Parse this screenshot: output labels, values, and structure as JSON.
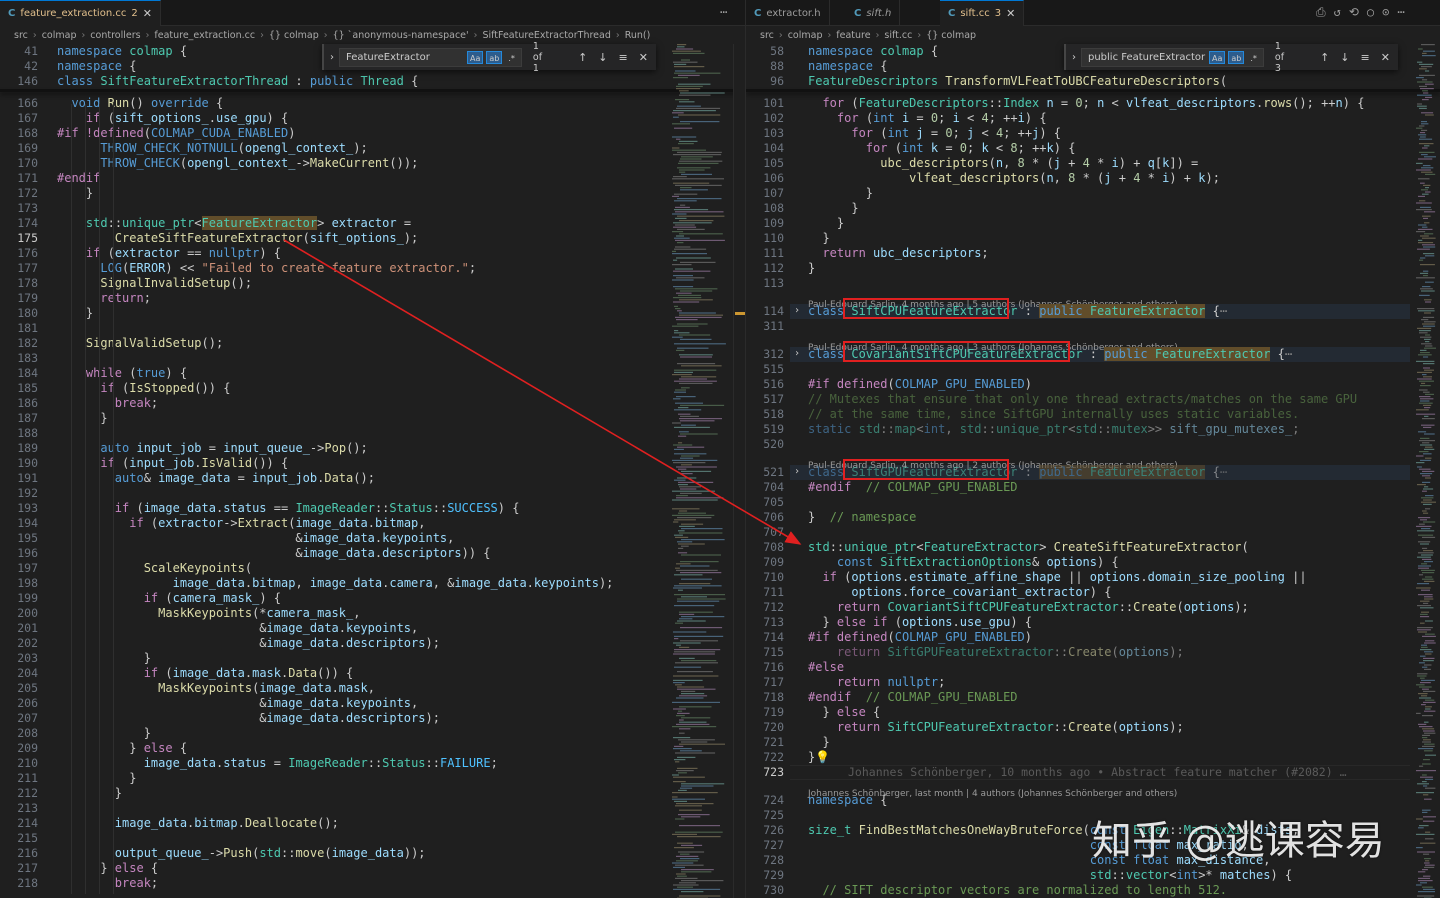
{
  "left": {
    "tabs": [
      {
        "icon": "C",
        "label": "feature_extraction.cc",
        "badge": "2",
        "active": true
      }
    ],
    "breadcrumb": [
      "src",
      "colmap",
      "controllers",
      "feature_extraction.cc",
      "{} colmap",
      "{} `anonymous-namespace'",
      "SiftFeatureExtractorThread",
      "Run()"
    ],
    "find_widget": {
      "value": "FeatureExtractor",
      "case_label": "Aa",
      "word_label": "ab",
      "regex_label": ".*",
      "count": "1 of 1"
    },
    "sticky_lines": [
      {
        "num": "41",
        "html": "<span class='k'>namespace</span> <span class='t'>colmap</span> {"
      },
      {
        "num": "42",
        "html": "<span class='k'>namespace</span> {"
      },
      {
        "num": "146",
        "html": "<span class='k'>class</span> <span class='t'>SiftFeatureExtractorThread</span> : <span class='k'>public</span> <span class='t'>Thread</span> {"
      }
    ],
    "lines": [
      {
        "num": "166",
        "html": "  <span class='k'>void</span> <span class='f'>Run</span>() <span class='k'>override</span> {"
      },
      {
        "num": "167",
        "html": "    <span class='kw'>if</span> (<span class='v'>sift_options_</span>.<span class='v'>use_gpu</span>) {"
      },
      {
        "num": "168",
        "html": "<span class='kw'>#if</span> <span class='kw'>!defined</span>(<span class='m'>COLMAP_CUDA_ENABLED</span>)"
      },
      {
        "num": "169",
        "html": "      <span class='m'>THROW_CHECK_NOTNULL</span>(<span class='v'>opengl_context_</span>);"
      },
      {
        "num": "170",
        "html": "      <span class='m'>THROW_CHECK</span>(<span class='v'>opengl_context_</span>-><span class='f'>MakeCurrent</span>());"
      },
      {
        "num": "171",
        "html": "<span class='kw'>#endif</span>"
      },
      {
        "num": "172",
        "html": "    }"
      },
      {
        "num": "173",
        "html": ""
      },
      {
        "num": "174",
        "html": "    <span class='t'>std</span>::<span class='t'>unique_ptr</span>&lt;<span class='t hl'>FeatureExtractor</span>&gt; <span class='v'>extractor</span> ="
      },
      {
        "num": "175",
        "html": "        <span class='f'>CreateSiftFeatureExtractor</span>(<span class='v'>sift_options_</span>);",
        "current": true
      },
      {
        "num": "176",
        "html": "    <span class='kw'>if</span> (<span class='v'>extractor</span> == <span class='k'>nullptr</span>) {"
      },
      {
        "num": "177",
        "html": "      <span class='m'>LOG</span>(<span class='v'>ERROR</span>) &lt;&lt; <span class='s'>\"Failed to create feature extractor.\"</span>;"
      },
      {
        "num": "178",
        "html": "      <span class='f'>SignalInvalidSetup</span>();"
      },
      {
        "num": "179",
        "html": "      <span class='kw'>return</span>;"
      },
      {
        "num": "180",
        "html": "    }"
      },
      {
        "num": "181",
        "html": ""
      },
      {
        "num": "182",
        "html": "    <span class='f'>SignalValidSetup</span>();"
      },
      {
        "num": "183",
        "html": ""
      },
      {
        "num": "184",
        "html": "    <span class='kw'>while</span> (<span class='k'>true</span>) {"
      },
      {
        "num": "185",
        "html": "      <span class='kw'>if</span> (<span class='f'>IsStopped</span>()) {"
      },
      {
        "num": "186",
        "html": "        <span class='kw'>break</span>;"
      },
      {
        "num": "187",
        "html": "      }"
      },
      {
        "num": "188",
        "html": ""
      },
      {
        "num": "189",
        "html": "      <span class='k'>auto</span> <span class='v'>input_job</span> = <span class='v'>input_queue_</span>-><span class='f'>Pop</span>();"
      },
      {
        "num": "190",
        "html": "      <span class='kw'>if</span> (<span class='v'>input_job</span>.<span class='f'>IsValid</span>()) {"
      },
      {
        "num": "191",
        "html": "        <span class='k'>auto</span>&amp; <span class='v'>image_data</span> = <span class='v'>input_job</span>.<span class='f'>Data</span>();"
      },
      {
        "num": "192",
        "html": ""
      },
      {
        "num": "193",
        "html": "        <span class='kw'>if</span> (<span class='v'>image_data</span>.<span class='v'>status</span> == <span class='t'>ImageReader</span>::<span class='t'>Status</span>::<span class='cst'>SUCCESS</span>) {"
      },
      {
        "num": "194",
        "html": "          <span class='kw'>if</span> (<span class='v'>extractor</span>-><span class='f'>Extract</span>(<span class='v'>image_data</span>.<span class='v'>bitmap</span>,"
      },
      {
        "num": "195",
        "html": "                                 &amp;<span class='v'>image_data</span>.<span class='v'>keypoints</span>,"
      },
      {
        "num": "196",
        "html": "                                 &amp;<span class='v'>image_data</span>.<span class='v'>descriptors</span>)) {"
      },
      {
        "num": "197",
        "html": "            <span class='f'>ScaleKeypoints</span>("
      },
      {
        "num": "198",
        "html": "                <span class='v'>image_data</span>.<span class='v'>bitmap</span>, <span class='v'>image_data</span>.<span class='v'>camera</span>, &amp;<span class='v'>image_data</span>.<span class='v'>keypoints</span>);"
      },
      {
        "num": "199",
        "html": "            <span class='kw'>if</span> (<span class='v'>camera_mask_</span>) {"
      },
      {
        "num": "200",
        "html": "              <span class='f'>MaskKeypoints</span>(*<span class='v'>camera_mask_</span>,"
      },
      {
        "num": "201",
        "html": "                            &amp;<span class='v'>image_data</span>.<span class='v'>keypoints</span>,"
      },
      {
        "num": "202",
        "html": "                            &amp;<span class='v'>image_data</span>.<span class='v'>descriptors</span>);"
      },
      {
        "num": "203",
        "html": "            }"
      },
      {
        "num": "204",
        "html": "            <span class='kw'>if</span> (<span class='v'>image_data</span>.<span class='v'>mask</span>.<span class='f'>Data</span>()) {"
      },
      {
        "num": "205",
        "html": "              <span class='f'>MaskKeypoints</span>(<span class='v'>image_data</span>.<span class='v'>mask</span>,"
      },
      {
        "num": "206",
        "html": "                            &amp;<span class='v'>image_data</span>.<span class='v'>keypoints</span>,"
      },
      {
        "num": "207",
        "html": "                            &amp;<span class='v'>image_data</span>.<span class='v'>descriptors</span>);"
      },
      {
        "num": "208",
        "html": "            }"
      },
      {
        "num": "209",
        "html": "          } <span class='kw'>else</span> {"
      },
      {
        "num": "210",
        "html": "            <span class='v'>image_data</span>.<span class='v'>status</span> = <span class='t'>ImageReader</span>::<span class='t'>Status</span>::<span class='cst'>FAILURE</span>;"
      },
      {
        "num": "211",
        "html": "          }"
      },
      {
        "num": "212",
        "html": "        }"
      },
      {
        "num": "213",
        "html": ""
      },
      {
        "num": "214",
        "html": "        <span class='v'>image_data</span>.<span class='v'>bitmap</span>.<span class='f'>Deallocate</span>();"
      },
      {
        "num": "215",
        "html": ""
      },
      {
        "num": "216",
        "html": "        <span class='v'>output_queue_</span>-><span class='f'>Push</span>(<span class='t'>std</span>::<span class='f'>move</span>(<span class='v'>image_data</span>));"
      },
      {
        "num": "217",
        "html": "      } <span class='kw'>else</span> {"
      },
      {
        "num": "218",
        "html": "        <span class='kw'>break</span>;"
      }
    ]
  },
  "right": {
    "tabs": [
      {
        "icon": "C",
        "label": "extractor.h",
        "badge": "",
        "active": false
      },
      {
        "icon": "C",
        "label": "sift.h",
        "badge": "",
        "active": false
      },
      {
        "icon": "C",
        "label": "sift.cc",
        "badge": "3",
        "active": true
      }
    ],
    "breadcrumb": [
      "src",
      "colmap",
      "feature",
      "sift.cc",
      "{} colmap"
    ],
    "find_widget": {
      "value": "public FeatureExtractor",
      "case_label": "Aa",
      "word_label": "ab",
      "regex_label": ".*",
      "count": "1 of 3"
    },
    "sticky_lines": [
      {
        "num": "58",
        "html": "<span class='k'>namespace</span> <span class='t'>colmap</span> {"
      },
      {
        "num": "88",
        "html": "<span class='k'>namespace</span> {"
      },
      {
        "num": "96",
        "html": "<span class='t'>FeatureDescriptors</span> <span class='f'>TransformVLFeatToUBCFeatureDescriptors</span>("
      }
    ],
    "blame_lines": [
      {
        "text": "Paul-Edouard Sarlin, 4 months ago | 5 authors (Johannes Schönberger and others)"
      },
      {
        "text": "Paul-Edouard Sarlin, 4 months ago | 3 authors (Johannes Schönberger and others)"
      },
      {
        "text": "Paul-Edouard Sarlin, 4 months ago | 2 authors (Johannes Schönberger and others)"
      },
      {
        "text": "Johannes Schönberger, last month | 4 authors (Johannes Schönberger and others)"
      }
    ],
    "inline_blame": "Johannes Schönberger, 10 months ago • Abstract feature matcher (#2082) …",
    "lines": [
      {
        "num": "101",
        "html": "  <span class='kw'>for</span> (<span class='t'>FeatureDescriptors</span>::<span class='t'>Index</span> <span class='v'>n</span> = <span class='n'>0</span>; <span class='v'>n</span> &lt; <span class='v'>vlfeat_descriptors</span>.<span class='f'>rows</span>(); ++<span class='v'>n</span>) {"
      },
      {
        "num": "102",
        "html": "    <span class='kw'>for</span> (<span class='k'>int</span> <span class='v'>i</span> = <span class='n'>0</span>; <span class='v'>i</span> &lt; <span class='n'>4</span>; ++<span class='v'>i</span>) {"
      },
      {
        "num": "103",
        "html": "      <span class='kw'>for</span> (<span class='k'>int</span> <span class='v'>j</span> = <span class='n'>0</span>; <span class='v'>j</span> &lt; <span class='n'>4</span>; ++<span class='v'>j</span>) {"
      },
      {
        "num": "104",
        "html": "        <span class='kw'>for</span> (<span class='k'>int</span> <span class='v'>k</span> = <span class='n'>0</span>; <span class='v'>k</span> &lt; <span class='n'>8</span>; ++<span class='v'>k</span>) {"
      },
      {
        "num": "105",
        "html": "          <span class='f'>ubc_descriptors</span>(<span class='v'>n</span>, <span class='n'>8</span> * (<span class='v'>j</span> + <span class='n'>4</span> * <span class='v'>i</span>) + <span class='v'>q</span>[<span class='v'>k</span>]) ="
      },
      {
        "num": "106",
        "html": "              <span class='f'>vlfeat_descriptors</span>(<span class='v'>n</span>, <span class='n'>8</span> * (<span class='v'>j</span> + <span class='n'>4</span> * <span class='v'>i</span>) + <span class='v'>k</span>);"
      },
      {
        "num": "107",
        "html": "        }"
      },
      {
        "num": "108",
        "html": "      }"
      },
      {
        "num": "109",
        "html": "    }"
      },
      {
        "num": "110",
        "html": "  }"
      },
      {
        "num": "111",
        "html": "  <span class='kw'>return</span> <span class='v'>ubc_descriptors</span>;"
      },
      {
        "num": "112",
        "html": "}"
      },
      {
        "num": "113",
        "html": ""
      },
      {
        "num": "",
        "html": "",
        "blame": 0
      },
      {
        "num": "114",
        "html": "<span class='k'>class</span> <span class='t'>SiftCPUFeatureExtractor</span> : <span class='k hl'>public</span><span class='hl'> </span><span class='t hl'>FeatureExtractor</span> {<span style='color:#888'>⋯</span>",
        "fold": true
      },
      {
        "num": "311",
        "html": ""
      },
      {
        "num": "",
        "html": "",
        "blame": 1
      },
      {
        "num": "312",
        "html": "<span class='k'>class</span> <span class='t'>CovariantSiftCPUFeatureExtractor</span> : <span class='k hl'>public</span><span class='hl'> </span><span class='t hl'>FeatureExtractor</span> {<span style='color:#888'>⋯</span>",
        "fold": true
      },
      {
        "num": "515",
        "html": ""
      },
      {
        "num": "516",
        "html": "<span class='kw'>#if</span> <span class='kw'>defined</span>(<span class='m'>COLMAP_GPU_ENABLED</span>)"
      },
      {
        "num": "517",
        "html": "<span class='c' style='opacity:.55'>// Mutexes that ensure that only one thread extracts/matches on the same GPU</span>"
      },
      {
        "num": "518",
        "html": "<span class='c' style='opacity:.55'>// at the same time, since SiftGPU internally uses static variables.</span>"
      },
      {
        "num": "519",
        "html": "<span style='opacity:.55'><span class='k'>static</span> <span class='t'>std</span>::<span class='t'>map</span>&lt;<span class='k'>int</span>, <span class='t'>std</span>::<span class='t'>unique_ptr</span>&lt;<span class='t'>std</span>::<span class='t'>mutex</span>&gt;&gt; <span class='v'>sift_gpu_mutexes_</span>;</span>"
      },
      {
        "num": "520",
        "html": ""
      },
      {
        "num": "",
        "html": "",
        "blame": 2
      },
      {
        "num": "521",
        "html": "<span style='opacity:.55'><span class='k'>class</span> <span class='t'>SiftGPUFeatureExtractor</span> : <span class='k hl'>public</span><span class='hl'> </span><span class='t hl'>FeatureExtractor</span> {<span style='color:#888'>⋯</span></span>",
        "fold": true
      },
      {
        "num": "704",
        "html": "<span class='kw'>#endif</span>  <span class='c'>// COLMAP_GPU_ENABLED</span>"
      },
      {
        "num": "705",
        "html": ""
      },
      {
        "num": "706",
        "html": "}  <span class='c'>// namespace</span>"
      },
      {
        "num": "707",
        "html": ""
      },
      {
        "num": "708",
        "html": "<span class='t'>std</span>::<span class='t'>unique_ptr</span>&lt;<span class='t'>FeatureExtractor</span>&gt; <span class='f'>CreateSiftFeatureExtractor</span>("
      },
      {
        "num": "709",
        "html": "    <span class='k'>const</span> <span class='t'>SiftExtractionOptions</span>&amp; <span class='v'>options</span>) {"
      },
      {
        "num": "710",
        "html": "  <span class='kw'>if</span> (<span class='v'>options</span>.<span class='v'>estimate_affine_shape</span> || <span class='v'>options</span>.<span class='v'>domain_size_pooling</span> ||"
      },
      {
        "num": "711",
        "html": "      <span class='v'>options</span>.<span class='v'>force_covariant_extractor</span>) {"
      },
      {
        "num": "712",
        "html": "    <span class='kw'>return</span> <span class='t'>CovariantSiftCPUFeatureExtractor</span>::<span class='f'>Create</span>(<span class='v'>options</span>);"
      },
      {
        "num": "713",
        "html": "  } <span class='kw'>else</span> <span class='kw'>if</span> (<span class='v'>options</span>.<span class='v'>use_gpu</span>) {"
      },
      {
        "num": "714",
        "html": "<span class='kw'>#if</span> <span class='kw'>defined</span>(<span class='m'>COLMAP_GPU_ENABLED</span>)"
      },
      {
        "num": "715",
        "html": "<span style='opacity:.55'>    <span class='kw'>return</span> <span class='t'>SiftGPUFeatureExtractor</span>::<span class='f'>Create</span>(<span class='v'>options</span>);</span>"
      },
      {
        "num": "716",
        "html": "<span class='kw'>#else</span>"
      },
      {
        "num": "717",
        "html": "    <span class='kw'>return</span> <span class='k'>nullptr</span>;"
      },
      {
        "num": "718",
        "html": "<span class='kw'>#endif</span>  <span class='c'>// COLMAP_GPU_ENABLED</span>"
      },
      {
        "num": "719",
        "html": "  } <span class='kw'>else</span> {"
      },
      {
        "num": "720",
        "html": "    <span class='kw'>return</span> <span class='t'>SiftCPUFeatureExtractor</span>::<span class='f'>Create</span>(<span class='v'>options</span>);"
      },
      {
        "num": "721",
        "html": "  }"
      },
      {
        "num": "722",
        "html": "}<span style='color:#ffcc00'>💡</span>"
      },
      {
        "num": "723",
        "html": "",
        "current": true,
        "inline_blame": true
      },
      {
        "num": "",
        "html": "",
        "blame": 3
      },
      {
        "num": "724",
        "html": "<span class='k'>namespace</span> {"
      },
      {
        "num": "725",
        "html": ""
      },
      {
        "num": "726",
        "html": "<span class='t'>size_t</span> <span class='f'>FindBestMatchesOneWayBruteForce</span>(<span class='k'>const</span> <span class='t'>Eigen</span>::<span class='t'>MatrixXi</span>&amp; <span class='v'>dists</span>,"
      },
      {
        "num": "727",
        "html": "                                       <span class='k'>const</span> <span class='k'>float</span> <span class='v'>max_ratio</span>,"
      },
      {
        "num": "728",
        "html": "                                       <span class='k'>const</span> <span class='k'>float</span> <span class='v'>max_distance</span>,"
      },
      {
        "num": "729",
        "html": "                                       <span class='t'>std</span>::<span class='t'>vector</span>&lt;<span class='k'>int</span>&gt;* <span class='v'>matches</span>) {"
      },
      {
        "num": "730",
        "html": "  <span class='c'>// SIFT descriptor vectors are normalized to length 512.</span>"
      }
    ]
  },
  "watermark": "知乎 @逃课容易",
  "colors": {
    "editor_bg": "#1f1f1f",
    "annotation": "#e02020",
    "match_highlight": "#614d2a"
  }
}
